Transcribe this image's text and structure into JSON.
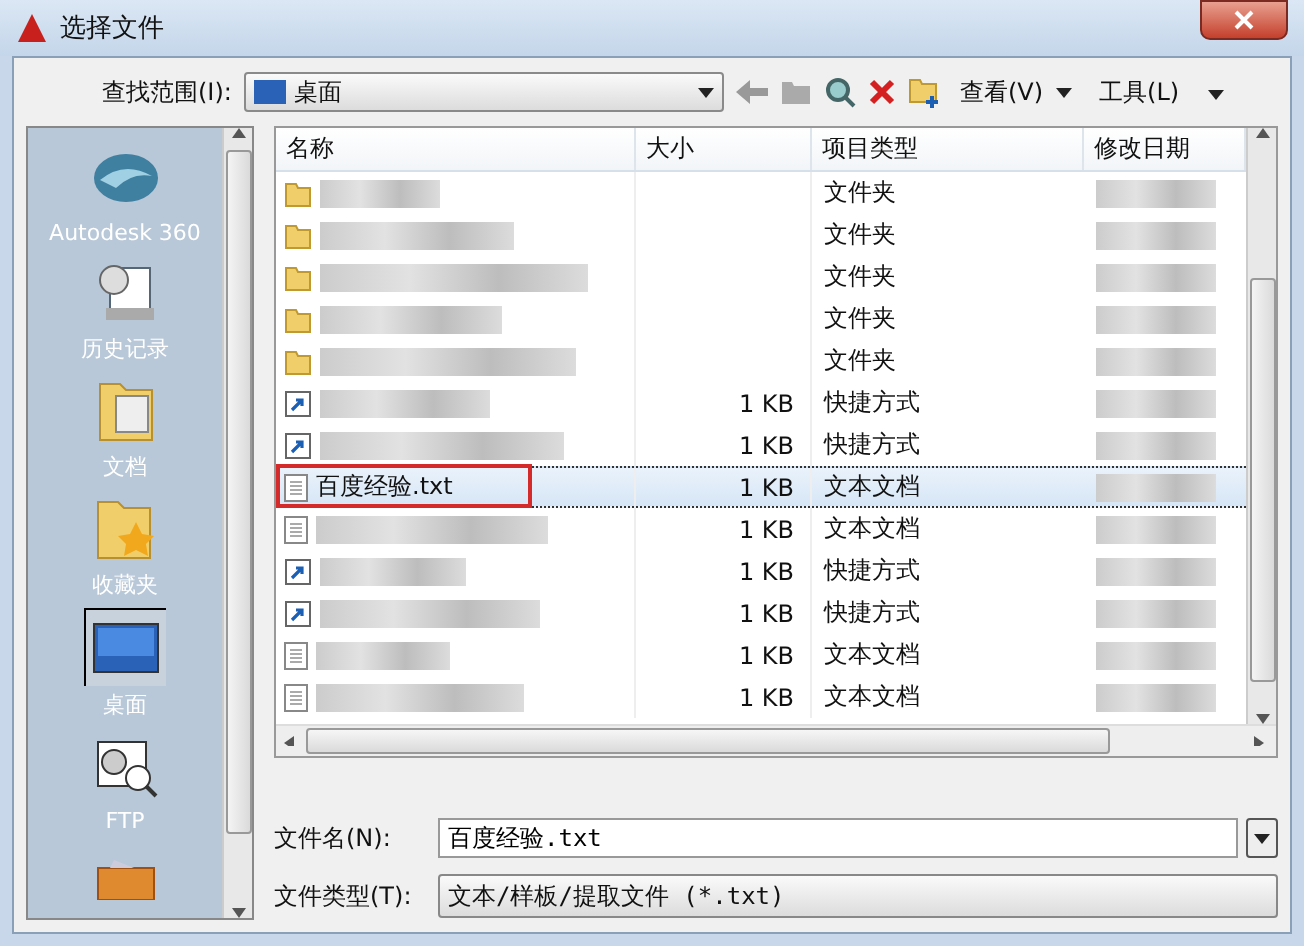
{
  "window": {
    "title": "选择文件"
  },
  "toolbar": {
    "look_in_label": "查找范围(I):",
    "look_in_value": "桌面",
    "view_label": "查看(V)",
    "tools_label": "工具(L)"
  },
  "sidebar": {
    "items": [
      {
        "label": "Autodesk 360",
        "kind": "cloud",
        "selected": false
      },
      {
        "label": "历史记录",
        "kind": "history",
        "selected": false
      },
      {
        "label": "文档",
        "kind": "documents",
        "selected": false
      },
      {
        "label": "收藏夹",
        "kind": "favorites",
        "selected": false
      },
      {
        "label": "桌面",
        "kind": "desktop",
        "selected": true
      },
      {
        "label": "FTP",
        "kind": "ftp",
        "selected": false
      },
      {
        "kind": "folder",
        "selected": false
      }
    ]
  },
  "table": {
    "columns": [
      "名称",
      "大小",
      "项目类型",
      "修改日期"
    ],
    "rows": [
      {
        "kind": "folder",
        "type": "文件夹",
        "selected": false,
        "marked": false
      },
      {
        "kind": "folder",
        "type": "文件夹",
        "selected": false,
        "marked": false
      },
      {
        "kind": "folder",
        "type": "文件夹",
        "selected": false,
        "marked": false
      },
      {
        "kind": "folder",
        "type": "文件夹",
        "selected": false,
        "marked": false
      },
      {
        "kind": "folder",
        "type": "文件夹",
        "selected": false,
        "marked": false
      },
      {
        "kind": "shortcut",
        "size": "1 KB",
        "type": "快捷方式",
        "selected": false,
        "marked": false
      },
      {
        "kind": "shortcut",
        "size": "1 KB",
        "type": "快捷方式",
        "selected": false,
        "marked": false
      },
      {
        "kind": "text",
        "name": "百度经验.txt",
        "size": "1 KB",
        "type": "文本文档",
        "selected": true,
        "marked": true
      },
      {
        "kind": "text",
        "size": "1 KB",
        "type": "文本文档",
        "selected": false,
        "marked": false
      },
      {
        "kind": "shortcut",
        "size": "1 KB",
        "type": "快捷方式",
        "selected": false,
        "marked": false
      },
      {
        "kind": "shortcut",
        "size": "1 KB",
        "type": "快捷方式",
        "selected": false,
        "marked": false
      },
      {
        "kind": "text",
        "size": "1 KB",
        "type": "文本文档",
        "selected": false,
        "marked": false
      },
      {
        "kind": "text",
        "size": "1 KB",
        "type": "文本文档",
        "selected": false,
        "marked": false
      }
    ]
  },
  "file_name": {
    "label": "文件名(N):",
    "value": "百度经验.txt"
  },
  "file_type": {
    "label": "文件类型(T):",
    "value": "文本/样板/提取文件 (*.txt)"
  }
}
